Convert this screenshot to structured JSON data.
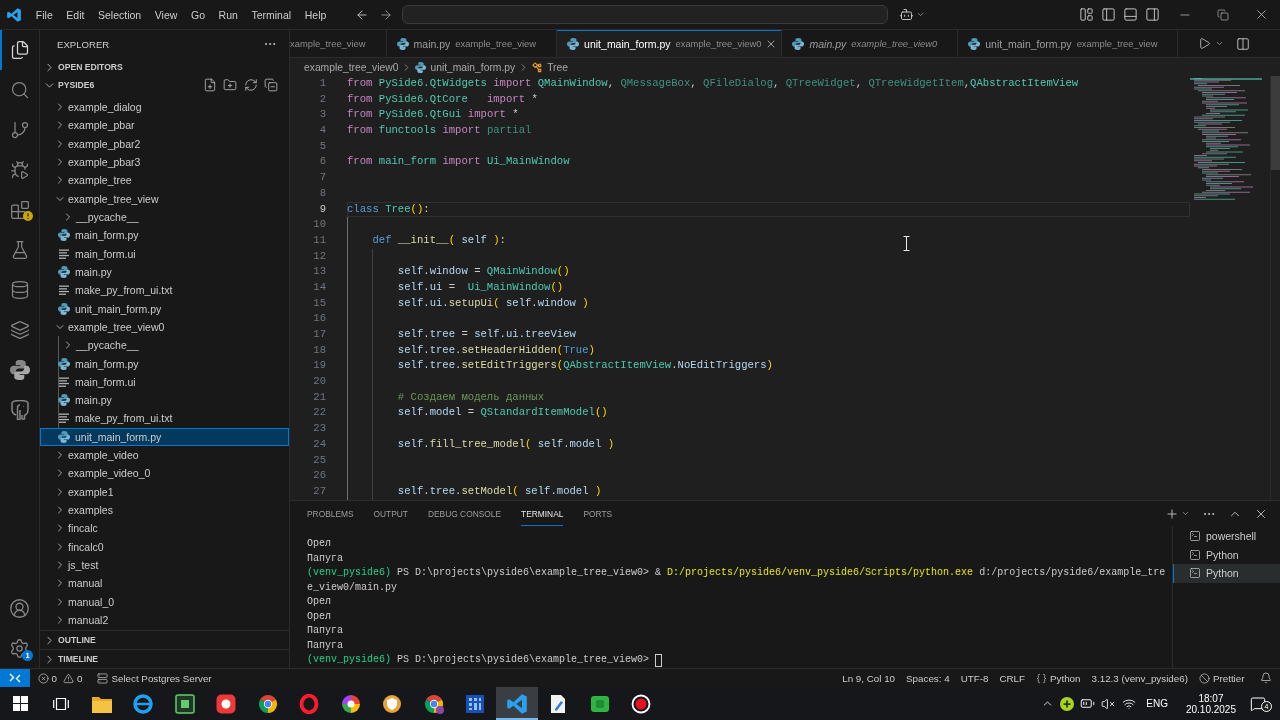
{
  "title_bar": {
    "menus": [
      "File",
      "Edit",
      "Selection",
      "View",
      "Go",
      "Run",
      "Terminal",
      "Help"
    ]
  },
  "activity_bar": {
    "items": [
      {
        "selected": true,
        "warning": false
      },
      {
        "selected": false,
        "warning": false
      },
      {
        "selected": false,
        "warning": false
      },
      {
        "selected": false,
        "warning": false
      },
      {
        "selected": false,
        "warning": true
      },
      {
        "selected": false,
        "warning": false
      },
      {
        "selected": false,
        "warning": false
      },
      {
        "selected": false,
        "warning": false
      },
      {
        "selected": false,
        "warning": false
      },
      {
        "selected": false,
        "warning": false
      }
    ],
    "manage_badge": "1"
  },
  "sidebar": {
    "title": "EXPLORER",
    "sections": [
      {
        "label": "OPEN EDITORS",
        "expanded": false
      },
      {
        "label": "PYSIDE6",
        "expanded": true,
        "tree": [
          {
            "label": "example_dialog",
            "kind": "folder",
            "expanded": false,
            "selected": false
          },
          {
            "label": "example_pbar",
            "kind": "folder",
            "expanded": false,
            "selected": false
          },
          {
            "label": "example_pbar2",
            "kind": "folder",
            "expanded": false,
            "selected": false
          },
          {
            "label": "example_pbar3",
            "kind": "folder",
            "expanded": false,
            "selected": false
          },
          {
            "label": "example_tree",
            "kind": "folder",
            "expanded": false,
            "selected": false
          },
          {
            "label": "example_tree_view",
            "kind": "folder",
            "expanded": true,
            "selected": false,
            "children": [
              {
                "label": "__pycache__",
                "kind": "folder",
                "expanded": false,
                "selected": false
              },
              {
                "label": "main_form.py",
                "kind": "python",
                "selected": false
              },
              {
                "label": "main_form.ui",
                "kind": "text",
                "selected": false
              },
              {
                "label": "main.py",
                "kind": "python",
                "selected": false
              },
              {
                "label": "make_py_from_ui.txt",
                "kind": "text",
                "selected": false
              },
              {
                "label": "unit_main_form.py",
                "kind": "python",
                "selected": false
              }
            ]
          },
          {
            "label": "example_tree_view0",
            "kind": "folder",
            "expanded": true,
            "selected": false,
            "children": [
              {
                "label": "__pycache__",
                "kind": "folder",
                "expanded": false,
                "selected": false
              },
              {
                "label": "main_form.py",
                "kind": "python",
                "selected": false
              },
              {
                "label": "main_form.ui",
                "kind": "text",
                "selected": false
              },
              {
                "label": "main.py",
                "kind": "python",
                "selected": false
              },
              {
                "label": "make_py_from_ui.txt",
                "kind": "text",
                "selected": false
              },
              {
                "label": "unit_main_form.py",
                "kind": "python",
                "selected": true
              }
            ]
          },
          {
            "label": "example_video",
            "kind": "folder",
            "expanded": false,
            "selected": false
          },
          {
            "label": "example_video_0",
            "kind": "folder",
            "expanded": false,
            "selected": false
          },
          {
            "label": "example1",
            "kind": "folder",
            "expanded": false,
            "selected": false
          },
          {
            "label": "examples",
            "kind": "folder",
            "expanded": false,
            "selected": false
          },
          {
            "label": "fincalc",
            "kind": "folder",
            "expanded": false,
            "selected": false
          },
          {
            "label": "fincalc0",
            "kind": "folder",
            "expanded": false,
            "selected": false
          },
          {
            "label": "js_test",
            "kind": "folder",
            "expanded": false,
            "selected": false
          },
          {
            "label": "manual",
            "kind": "folder",
            "expanded": false,
            "selected": false
          },
          {
            "label": "manual_0",
            "kind": "folder",
            "expanded": false,
            "selected": false
          },
          {
            "label": "manual2",
            "kind": "folder",
            "expanded": false,
            "selected": false
          }
        ]
      },
      {
        "label": "OUTLINE",
        "expanded": false
      },
      {
        "label": "TIMELINE",
        "expanded": false
      }
    ]
  },
  "editor": {
    "tabs": [
      {
        "description": "xample_tree_view",
        "selected": false,
        "preview": false
      },
      {
        "label": "main.py",
        "description": "example_tree_view",
        "selected": false,
        "preview": false
      },
      {
        "label": "unit_main_form.py",
        "description": "example_tree_view0",
        "selected": true,
        "preview": false
      },
      {
        "label": "main.py",
        "description": "example_tree_view0",
        "selected": false,
        "preview": true
      },
      {
        "label": "unit_main_form.py",
        "description": "example_tree_view",
        "selected": false,
        "preview": false
      }
    ],
    "breadcrumbs": [
      {
        "label": "example_tree_view0",
        "kind": "folder"
      },
      {
        "label": "unit_main_form.py",
        "kind": "python"
      },
      {
        "label": "Tree",
        "kind": "class"
      }
    ],
    "lines": [
      {
        "number": "1",
        "current": false,
        "tokens": [
          {
            "text": "from ",
            "kind": "keyword"
          },
          {
            "text": "PySide6.QtWidgets ",
            "kind": "type"
          },
          {
            "text": "import ",
            "kind": "keyword"
          },
          {
            "text": "QMainWindow",
            "kind": "type"
          },
          {
            "text": ", ",
            "kind": "plain"
          },
          {
            "text": "QMessageBox",
            "kind": "dim"
          },
          {
            "text": ", ",
            "kind": "plain"
          },
          {
            "text": "QFileDialog",
            "kind": "dim"
          },
          {
            "text": ", ",
            "kind": "plain"
          },
          {
            "text": "QTreeWidget",
            "kind": "dim"
          },
          {
            "text": ", ",
            "kind": "plain"
          },
          {
            "text": "QTreeWidgetItem",
            "kind": "dim"
          },
          {
            "text": ",",
            "kind": "plain"
          },
          {
            "text": "QAbstractItemView",
            "kind": "type"
          }
        ]
      },
      {
        "number": "2",
        "current": false,
        "tokens": [
          {
            "text": "from ",
            "kind": "keyword"
          },
          {
            "text": "PySide6.QtCore   ",
            "kind": "type"
          },
          {
            "text": "import ",
            "kind": "keyword"
          },
          {
            "text": "*",
            "kind": "plain"
          }
        ]
      },
      {
        "number": "3",
        "current": false,
        "tokens": [
          {
            "text": "from ",
            "kind": "keyword"
          },
          {
            "text": "PySide6.QtGui ",
            "kind": "type"
          },
          {
            "text": "import ",
            "kind": "keyword"
          },
          {
            "text": "*",
            "kind": "plain"
          }
        ]
      },
      {
        "number": "4",
        "current": false,
        "tokens": [
          {
            "text": "from ",
            "kind": "keyword"
          },
          {
            "text": "functools ",
            "kind": "type"
          },
          {
            "text": "import ",
            "kind": "keyword"
          },
          {
            "text": "partial",
            "kind": "dim"
          }
        ]
      },
      {
        "number": "5",
        "current": false
      },
      {
        "number": "6",
        "current": false,
        "tokens": [
          {
            "text": "from ",
            "kind": "keyword"
          },
          {
            "text": "main_form ",
            "kind": "type"
          },
          {
            "text": "import ",
            "kind": "keyword"
          },
          {
            "text": "Ui_MainWindow",
            "kind": "type"
          }
        ]
      },
      {
        "number": "7",
        "current": false
      },
      {
        "number": "8",
        "current": false
      },
      {
        "number": "9",
        "current": true,
        "tokens": [
          {
            "text": "class ",
            "kind": "storage"
          },
          {
            "text": "Tree",
            "kind": "type"
          },
          {
            "text": "()",
            "kind": "paren"
          },
          {
            "text": ":",
            "kind": "plain"
          }
        ]
      },
      {
        "number": "10",
        "current": false
      },
      {
        "number": "11",
        "current": false,
        "tokens": [
          {
            "text": "    def ",
            "kind": "storage"
          },
          {
            "text": "__init__",
            "kind": "function"
          },
          {
            "text": "(",
            "kind": "paren"
          },
          {
            "text": " self ",
            "kind": "variable"
          },
          {
            "text": ")",
            "kind": "paren"
          },
          {
            "text": ":",
            "kind": "plain"
          }
        ]
      },
      {
        "number": "12",
        "current": false
      },
      {
        "number": "13",
        "current": false,
        "tokens": [
          {
            "text": "        self.window",
            "kind": "variable"
          },
          {
            "text": " = ",
            "kind": "plain"
          },
          {
            "text": "QMainWindow",
            "kind": "type"
          },
          {
            "text": "()",
            "kind": "paren"
          }
        ]
      },
      {
        "number": "14",
        "current": false,
        "tokens": [
          {
            "text": "        self.ui",
            "kind": "variable"
          },
          {
            "text": " =  ",
            "kind": "plain"
          },
          {
            "text": "Ui_MainWindow",
            "kind": "type"
          },
          {
            "text": "()",
            "kind": "paren"
          }
        ]
      },
      {
        "number": "15",
        "current": false,
        "tokens": [
          {
            "text": "        self.ui.",
            "kind": "variable"
          },
          {
            "text": "setupUi",
            "kind": "function"
          },
          {
            "text": "(",
            "kind": "paren"
          },
          {
            "text": " self.window ",
            "kind": "variable"
          },
          {
            "text": ")",
            "kind": "paren"
          }
        ]
      },
      {
        "number": "16",
        "current": false
      },
      {
        "number": "17",
        "current": false,
        "tokens": [
          {
            "text": "        self.tree",
            "kind": "variable"
          },
          {
            "text": " = ",
            "kind": "plain"
          },
          {
            "text": "self.ui.treeView",
            "kind": "variable"
          }
        ]
      },
      {
        "number": "18",
        "current": false,
        "tokens": [
          {
            "text": "        self.tree.",
            "kind": "variable"
          },
          {
            "text": "setHeaderHidden",
            "kind": "function"
          },
          {
            "text": "(",
            "kind": "paren"
          },
          {
            "text": "True",
            "kind": "storage"
          },
          {
            "text": ")",
            "kind": "paren"
          }
        ]
      },
      {
        "number": "19",
        "current": false,
        "tokens": [
          {
            "text": "        self.tree.",
            "kind": "variable"
          },
          {
            "text": "setEditTriggers",
            "kind": "function"
          },
          {
            "text": "(",
            "kind": "paren"
          },
          {
            "text": "QAbstractItemView",
            "kind": "type"
          },
          {
            "text": ".",
            "kind": "plain"
          },
          {
            "text": "NoEditTriggers",
            "kind": "variable"
          },
          {
            "text": ")",
            "kind": "paren"
          }
        ]
      },
      {
        "number": "20",
        "current": false
      },
      {
        "number": "21",
        "current": false,
        "tokens": [
          {
            "text": "        # Создаем модель данных",
            "kind": "comment"
          }
        ]
      },
      {
        "number": "22",
        "current": false,
        "tokens": [
          {
            "text": "        self.model",
            "kind": "variable"
          },
          {
            "text": " = ",
            "kind": "plain"
          },
          {
            "text": "QStandardItemModel",
            "kind": "type"
          },
          {
            "text": "()",
            "kind": "paren"
          }
        ]
      },
      {
        "number": "23",
        "current": false
      },
      {
        "number": "24",
        "current": false,
        "tokens": [
          {
            "text": "        self.",
            "kind": "variable"
          },
          {
            "text": "fill_tree_model",
            "kind": "function"
          },
          {
            "text": "(",
            "kind": "paren"
          },
          {
            "text": " self.model ",
            "kind": "variable"
          },
          {
            "text": ")",
            "kind": "paren"
          }
        ]
      },
      {
        "number": "25",
        "current": false
      },
      {
        "number": "26",
        "current": false
      },
      {
        "number": "27",
        "current": false,
        "tokens": [
          {
            "text": "        self.tree.",
            "kind": "variable"
          },
          {
            "text": "setModel",
            "kind": "function"
          },
          {
            "text": "(",
            "kind": "paren"
          },
          {
            "text": " self.model ",
            "kind": "variable"
          },
          {
            "text": ")",
            "kind": "paren"
          }
        ]
      }
    ]
  },
  "panel": {
    "tabs": [
      {
        "label": "PROBLEMS",
        "selected": false
      },
      {
        "label": "OUTPUT",
        "selected": false
      },
      {
        "label": "DEBUG CONSOLE",
        "selected": false
      },
      {
        "label": "TERMINAL",
        "selected": true
      },
      {
        "label": "PORTS",
        "selected": false
      }
    ],
    "terminal_lines": [
      {
        "cursor": false,
        "tokens": [
          {
            "text": "Орел",
            "kind": "plain"
          }
        ]
      },
      {
        "cursor": false,
        "tokens": [
          {
            "text": "Папуга",
            "kind": "plain"
          }
        ]
      },
      {
        "cursor": false,
        "tokens": [
          {
            "text": "(venv_pyside6)",
            "kind": "env"
          },
          {
            "text": " PS D:\\projects\\pyside6\\example_tree_view0> & ",
            "kind": "plain"
          },
          {
            "text": "D:/projects/pyside6/venv_pyside6/Scripts/python.exe",
            "kind": "command"
          },
          {
            "text": " d:/projects/pyside6/example_tre",
            "kind": "plain"
          }
        ]
      },
      {
        "cursor": false,
        "tokens": [
          {
            "text": "e_view0/main.py",
            "kind": "plain"
          }
        ]
      },
      {
        "cursor": false,
        "tokens": [
          {
            "text": "Орел",
            "kind": "plain"
          }
        ]
      },
      {
        "cursor": false,
        "tokens": [
          {
            "text": "Орел",
            "kind": "plain"
          }
        ]
      },
      {
        "cursor": false,
        "tokens": [
          {
            "text": "Папуга",
            "kind": "plain"
          }
        ]
      },
      {
        "cursor": false,
        "tokens": [
          {
            "text": "Папуга",
            "kind": "plain"
          }
        ]
      },
      {
        "cursor": true,
        "tokens": [
          {
            "text": "(venv_pyside6)",
            "kind": "env"
          },
          {
            "text": " PS D:\\projects\\pyside6\\example_tree_view0> ",
            "kind": "plain"
          }
        ]
      }
    ],
    "terminals": [
      {
        "label": "powershell",
        "selected": false
      },
      {
        "label": "Python",
        "selected": false
      },
      {
        "label": "Python",
        "selected": true
      }
    ]
  },
  "status_bar": {
    "problems": {
      "errors": "0",
      "warnings": "0"
    },
    "left": [
      {
        "label": "Select Postgres Server",
        "kind": "server"
      }
    ],
    "right": [
      {
        "label": "Ln 9, Col 10",
        "kind": "plain"
      },
      {
        "label": "Spaces: 4",
        "kind": "plain"
      },
      {
        "label": "UTF-8",
        "kind": "plain"
      },
      {
        "label": "CRLF",
        "kind": "plain"
      },
      {
        "label": "Python",
        "kind": "language"
      },
      {
        "label": "3.12.3 (venv_pyside6)",
        "kind": "plain"
      },
      {
        "label": "Prettier",
        "kind": "formatter"
      }
    ]
  },
  "taskbar": {
    "apps": [
      {
        "selected": false
      },
      {
        "selected": false
      },
      {
        "selected": false
      },
      {
        "selected": false
      },
      {
        "selected": false
      },
      {
        "selected": false
      },
      {
        "selected": false
      },
      {
        "selected": false
      },
      {
        "selected": false
      },
      {
        "selected": false
      },
      {
        "selected": true
      },
      {
        "selected": false
      },
      {
        "selected": false
      },
      {
        "selected": false
      }
    ],
    "tray": {
      "language": "ENG",
      "time": "18:07",
      "date": "20.10.2025",
      "notifications": "4"
    }
  }
}
